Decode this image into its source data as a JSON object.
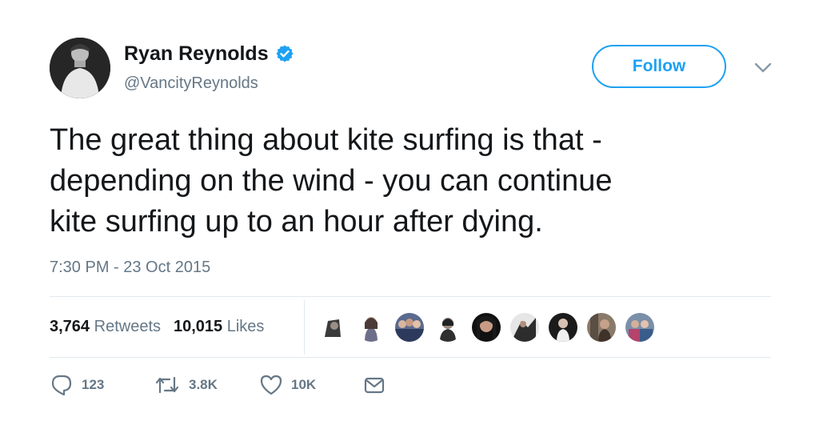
{
  "author": {
    "display_name": "Ryan Reynolds",
    "handle": "@VancityReynolds",
    "verified": true
  },
  "follow_button": {
    "label": "Follow"
  },
  "tweet": {
    "lines": [
      "The great thing about kite surfing is that -",
      "depending on the wind - you can continue",
      "kite surfing up to an hour after dying."
    ],
    "timestamp": "7:30 PM - 23 Oct 2015"
  },
  "stats": {
    "retweets_count": "3,764",
    "retweets_label": "Retweets",
    "likes_count": "10,015",
    "likes_label": "Likes"
  },
  "liker_avatars": [
    "liker-1",
    "liker-2",
    "liker-3",
    "liker-4",
    "liker-5",
    "liker-6",
    "liker-7",
    "liker-8",
    "liker-9",
    "liker-10"
  ],
  "actions": {
    "reply_count": "123",
    "retweet_count": "3.8K",
    "like_count": "10K"
  },
  "colors": {
    "accent": "#1da1f2",
    "text": "#14171a",
    "muted": "#657786",
    "divider": "#e1e8ed"
  },
  "icons": {
    "verified": "verified-badge-icon",
    "caret": "chevron-down-icon",
    "reply": "reply-icon",
    "retweet": "retweet-icon",
    "like": "heart-icon",
    "message": "envelope-icon"
  }
}
